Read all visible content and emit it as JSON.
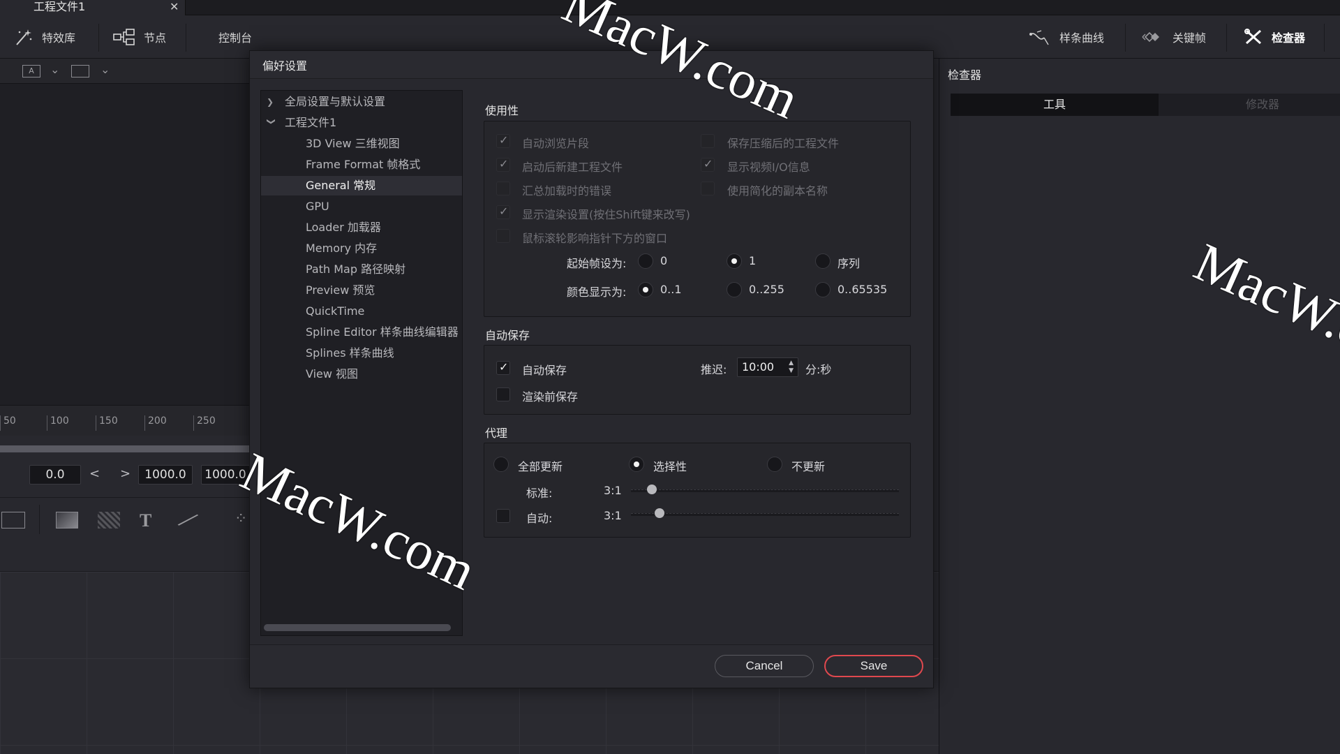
{
  "app": {
    "project_tab": "工程文件1",
    "close_glyph": "✕"
  },
  "toolbar": {
    "effects": "特效库",
    "nodes": "节点",
    "console": "控制台",
    "spline": "样条曲线",
    "keyframes": "关键帧",
    "inspector": "检查器"
  },
  "subbar": {
    "text_icon_label": "A"
  },
  "ruler": {
    "ticks": [
      "50",
      "100",
      "150",
      "200",
      "250"
    ]
  },
  "timebar": {
    "start": "0.0",
    "end": "1000.0",
    "render_end": "1000.0"
  },
  "inspector": {
    "title": "检查器",
    "tab_tools": "工具",
    "tab_modifiers": "修改器"
  },
  "dialog": {
    "title": "偏好设置",
    "tree": [
      {
        "label": "全局设置与默认设置",
        "level": 0,
        "chevron": "›"
      },
      {
        "label": "工程文件1",
        "level": 0,
        "chevron": "⌄"
      },
      {
        "label": "3D View 三维视图",
        "level": 1
      },
      {
        "label": "Frame Format 帧格式",
        "level": 1
      },
      {
        "label": "General 常规",
        "level": 1,
        "selected": true
      },
      {
        "label": "GPU",
        "level": 1
      },
      {
        "label": "Loader 加载器",
        "level": 1
      },
      {
        "label": "Memory 内存",
        "level": 1
      },
      {
        "label": "Path Map 路径映射",
        "level": 1
      },
      {
        "label": "Preview 预览",
        "level": 1
      },
      {
        "label": "QuickTime",
        "level": 1
      },
      {
        "label": "Spline Editor 样条曲线编辑器",
        "level": 1
      },
      {
        "label": "Splines 样条曲线",
        "level": 1
      },
      {
        "label": "View 视图",
        "level": 1
      }
    ],
    "usability": {
      "title": "使用性",
      "auto_browse": "自动浏览片段",
      "save_compressed": "保存压缩后的工程文件",
      "new_project_on_start": "启动后新建工程文件",
      "show_video_io": "显示视频I/O信息",
      "summarize_errors": "汇总加载时的错误",
      "simplified_copy_names": "使用简化的副本名称",
      "show_render_settings": "显示渲染设置(按住Shift键来改写)",
      "wheel_affects_under_pointer": "鼠标滚轮影响指针下方的窗口",
      "start_frame_label": "起始帧设为:",
      "start_frame_options": [
        "0",
        "1",
        "序列"
      ],
      "start_frame_selected": "1",
      "color_display_label": "颜色显示为:",
      "color_display_options": [
        "0..1",
        "0..255",
        "0..65535"
      ],
      "color_display_selected": "0..1"
    },
    "autosave": {
      "title": "自动保存",
      "autosave": "自动保存",
      "autosave_checked": true,
      "delay_label": "推迟:",
      "delay_value": "10:00",
      "delay_unit": "分:秒",
      "save_before_render": "渲染前保存",
      "save_before_render_checked": false
    },
    "proxy": {
      "title": "代理",
      "options": [
        "全部更新",
        "选择性",
        "不更新"
      ],
      "selected": "选择性",
      "standard_label": "标准:",
      "standard_value": "3:1",
      "auto_label": "自动:",
      "auto_value": "3:1",
      "auto_checked": false
    },
    "cancel": "Cancel",
    "save": "Save"
  },
  "watermark": "MacW.com",
  "colors": {
    "accent_save": "#e0484e",
    "panel": "#28282e",
    "dialog": "#2a2a30"
  }
}
